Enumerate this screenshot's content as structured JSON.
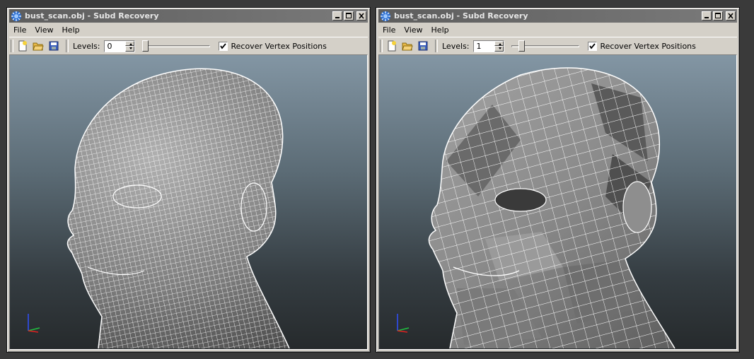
{
  "windows": [
    {
      "title": "bust_scan.obj - Subd Recovery",
      "menu": [
        "File",
        "View",
        "Help"
      ],
      "toolbar": {
        "levels_label": "Levels:",
        "levels_value": "0",
        "slider_level": 0,
        "checkbox_checked": true,
        "checkbox_label": "Recover Vertex Positions"
      },
      "mesh_style": "dense-wireframe"
    },
    {
      "title": "bust_scan.obj - Subd Recovery",
      "menu": [
        "File",
        "View",
        "Help"
      ],
      "toolbar": {
        "levels_label": "Levels:",
        "levels_value": "1",
        "slider_level": 1,
        "checkbox_checked": true,
        "checkbox_label": "Recover Vertex Positions"
      },
      "mesh_style": "coarse-faceted"
    }
  ],
  "colors": {
    "viewport_top": "#8396a4",
    "viewport_bottom": "#262a2c",
    "mesh_fill": "#8a8a8a",
    "wire": "#ffffff",
    "axis_x": "#e02020",
    "axis_y": "#20c040",
    "axis_z": "#3050ff"
  },
  "icons": {
    "app": "gear-icon",
    "new": "new-file-icon",
    "open": "open-folder-icon",
    "save": "save-icon",
    "minimize": "minimize-icon",
    "maximize": "maximize-icon",
    "close": "close-icon"
  }
}
